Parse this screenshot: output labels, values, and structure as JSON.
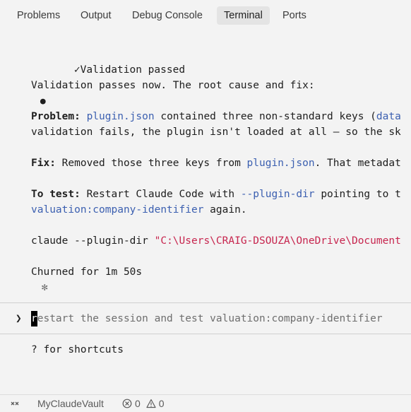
{
  "tabs": [
    {
      "label": "Problems"
    },
    {
      "label": "Output"
    },
    {
      "label": "Debug Console"
    },
    {
      "label": "Terminal",
      "active": true
    },
    {
      "label": "Ports"
    }
  ],
  "terminal": {
    "check_glyph": "✓",
    "validation_msg": "Validation passed",
    "bullet_glyph": "●",
    "summary": "Validation passes now. The root cause and fix:",
    "problem": {
      "label": "Problem:",
      "seg1": " ",
      "file": "plugin.json",
      "seg2": " contained three non-standard keys (",
      "trailing": "data",
      "line2": "validation fails, the plugin isn't loaded at all — so the sk"
    },
    "fix": {
      "label": "Fix:",
      "seg1": " Removed those three keys from ",
      "file": "plugin.json",
      "seg2": ". That metadat"
    },
    "test": {
      "label": "To test:",
      "seg1": " Restart Claude Code with ",
      "flag": "--plugin-dir",
      "seg2": " pointing to t",
      "line2_accent": "valuation:company-identifier",
      "line2_rest": " again."
    },
    "command": {
      "prefix": "claude --plugin-dir ",
      "path": "\"C:\\Users\\CRAIG-DSOUZA\\OneDrive\\Document"
    },
    "spinner_glyph": "✻",
    "churn": "Churned for 1m 50s",
    "prompt": {
      "arrow": "❯",
      "cursor_char": "r",
      "placeholder_rest": "estart the session and test valuation:company-identifier"
    },
    "shortcuts": "? for shortcuts"
  },
  "statusbar": {
    "project": "MyClaudeVault",
    "errors": "0",
    "warnings": "0"
  },
  "colors": {
    "accent": "#3b5fb0",
    "path": "#c7254e",
    "background": "#f3f3f3"
  },
  "icons": [
    "remote-icon",
    "error-icon",
    "warning-icon"
  ]
}
